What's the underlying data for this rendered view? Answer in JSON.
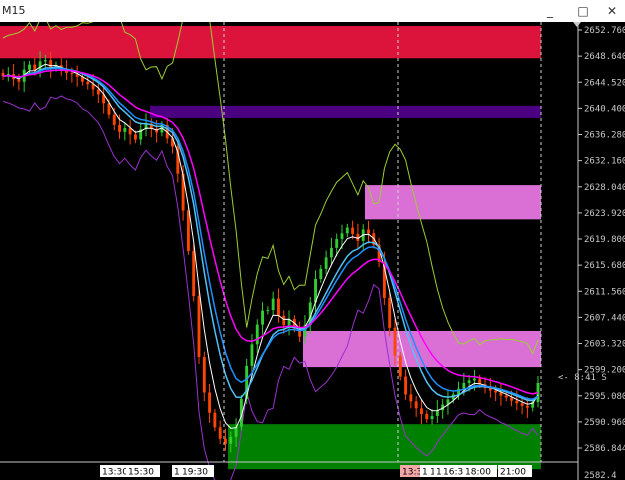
{
  "window": {
    "title": "M15",
    "minimize_glyph": "_",
    "maximize_glyph": "□",
    "close_glyph": "✕"
  },
  "axis": {
    "price_labels": [
      "2652.760",
      "2648.640",
      "2644.520",
      "2640.400",
      "2636.280",
      "2632.160",
      "2628.040",
      "2623.920",
      "2619.800",
      "2615.680",
      "2611.560",
      "2607.440",
      "2603.320",
      "2599.200",
      "2595.080",
      "2590.960",
      "2586.844"
    ],
    "bottom_cut_label": "2582.4"
  },
  "time_labels": [
    {
      "text": "13:30",
      "bg": "#ffffff",
      "fg": "#000000"
    },
    {
      "text": "15:30",
      "bg": "#ffffff",
      "fg": "#000000"
    },
    {
      "text": "1",
      "bg": "#ffffff",
      "fg": "#000000"
    },
    {
      "text": "19:30",
      "bg": "#ffffff",
      "fg": "#000000"
    },
    {
      "text": "13:30",
      "bg": "#f4a7a7",
      "fg": "#000000"
    },
    {
      "text": "1",
      "bg": "#ffffff",
      "fg": "#000000"
    },
    {
      "text": "1",
      "bg": "#ffffff",
      "fg": "#000000"
    },
    {
      "text": "1",
      "bg": "#ffffff",
      "fg": "#000000"
    },
    {
      "text": "16:30",
      "bg": "#ffffff",
      "fg": "#000000"
    },
    {
      "text": "18:00",
      "bg": "#ffffff",
      "fg": "#000000"
    },
    {
      "text": "21:00",
      "bg": "#ffffff",
      "fg": "#000000"
    }
  ],
  "countdown": "<- 8:41 S",
  "zones": [
    {
      "name": "supply-zone-top",
      "color": "#dc143c",
      "price_top": 2653.4,
      "price_bottom": 2648.3
    },
    {
      "name": "zone-purple",
      "color": "#4b0082",
      "price_top": 2640.8,
      "price_bottom": 2638.9
    },
    {
      "name": "zone-pink-upper",
      "color": "#da70d6",
      "price_top": 2628.3,
      "price_bottom": 2622.9
    },
    {
      "name": "zone-pink-lower",
      "color": "#da70d6",
      "price_top": 2605.3,
      "price_bottom": 2599.6
    },
    {
      "name": "demand-zone-bottom",
      "color": "#008000",
      "price_top": 2590.6,
      "price_bottom": 2583.5
    }
  ],
  "colors": {
    "bull": "#32cd32",
    "bear": "#ff4500",
    "ma_white": "#ffffff",
    "ma_blue": "#1e90ff",
    "ma_cyan": "#4fc3f7",
    "ma_magenta": "#ff00ff",
    "band_yellow": "#9acd32",
    "band_purple": "#9932cc",
    "grid": "#3a3a3a"
  }
}
